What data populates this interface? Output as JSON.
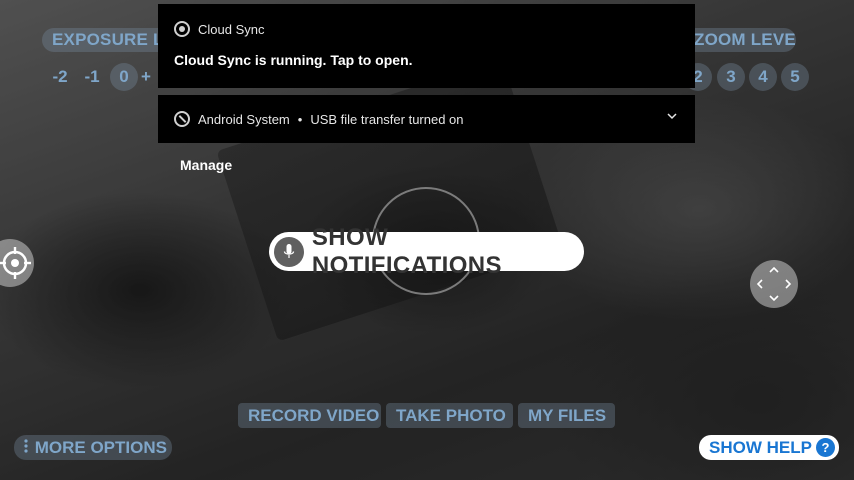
{
  "camera": {
    "exposure_title": "EXPOSURE LEVEL",
    "exposure_levels": [
      "-2",
      "-1",
      "0",
      "+"
    ],
    "zoom_title": "ZOOM LEVEL",
    "zoom_levels": [
      "2",
      "3",
      "4",
      "5"
    ]
  },
  "notifications": [
    {
      "app": "Cloud Sync",
      "body": "Cloud Sync is running. Tap to open.",
      "icon": "cloud-sync-icon"
    },
    {
      "app": "Android System",
      "separator": "•",
      "body": "USB file transfer turned on",
      "icon": "android-system-icon"
    }
  ],
  "manage_label": "Manage",
  "voice_hint": {
    "label": "SHOW NOTIFICATIONS",
    "icon": "microphone-icon"
  },
  "bottom": {
    "record_video": "RECORD VIDEO",
    "take_photo": "TAKE PHOTO",
    "my_files": "MY FILES",
    "more_options": "MORE OPTIONS",
    "show_help": "SHOW HELP",
    "help_icon_text": "?"
  },
  "colors": {
    "accent_blue": "#1976d2",
    "chip_text": "#7fa6c9"
  }
}
